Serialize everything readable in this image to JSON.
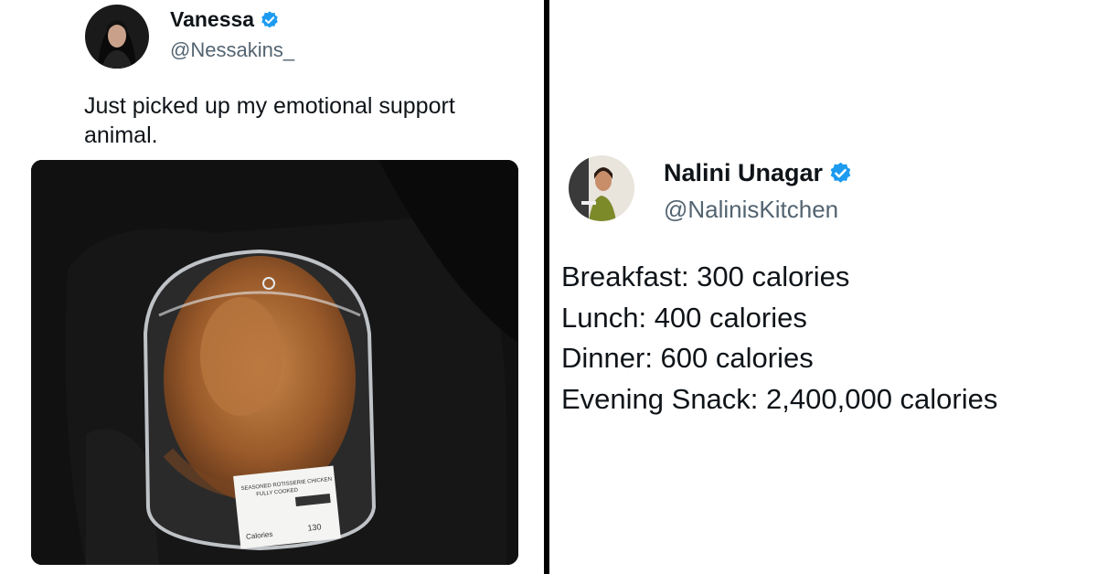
{
  "tweets": [
    {
      "display_name": "Vanessa",
      "handle": "@Nessakins_",
      "verified": true,
      "text": "Just picked up my emotional support animal.",
      "media": {
        "label_title": "SEASONED ROTISSERIE CHICKEN",
        "label_sub": "FULLY COOKED",
        "label_calories": "Calories",
        "label_calorie_value": "130"
      }
    },
    {
      "display_name": "Nalini Unagar",
      "handle": "@NalinisKitchen",
      "verified": true,
      "lines": [
        "Breakfast: 300 calories",
        "Lunch: 400 calories",
        "Dinner: 600 calories",
        "Evening Snack: 2,400,000 calories"
      ]
    }
  ],
  "colors": {
    "verified_badge": "#1d9bf0",
    "handle_text": "#536471",
    "divider": "#000000"
  },
  "icons": [
    "verified-badge-icon"
  ]
}
